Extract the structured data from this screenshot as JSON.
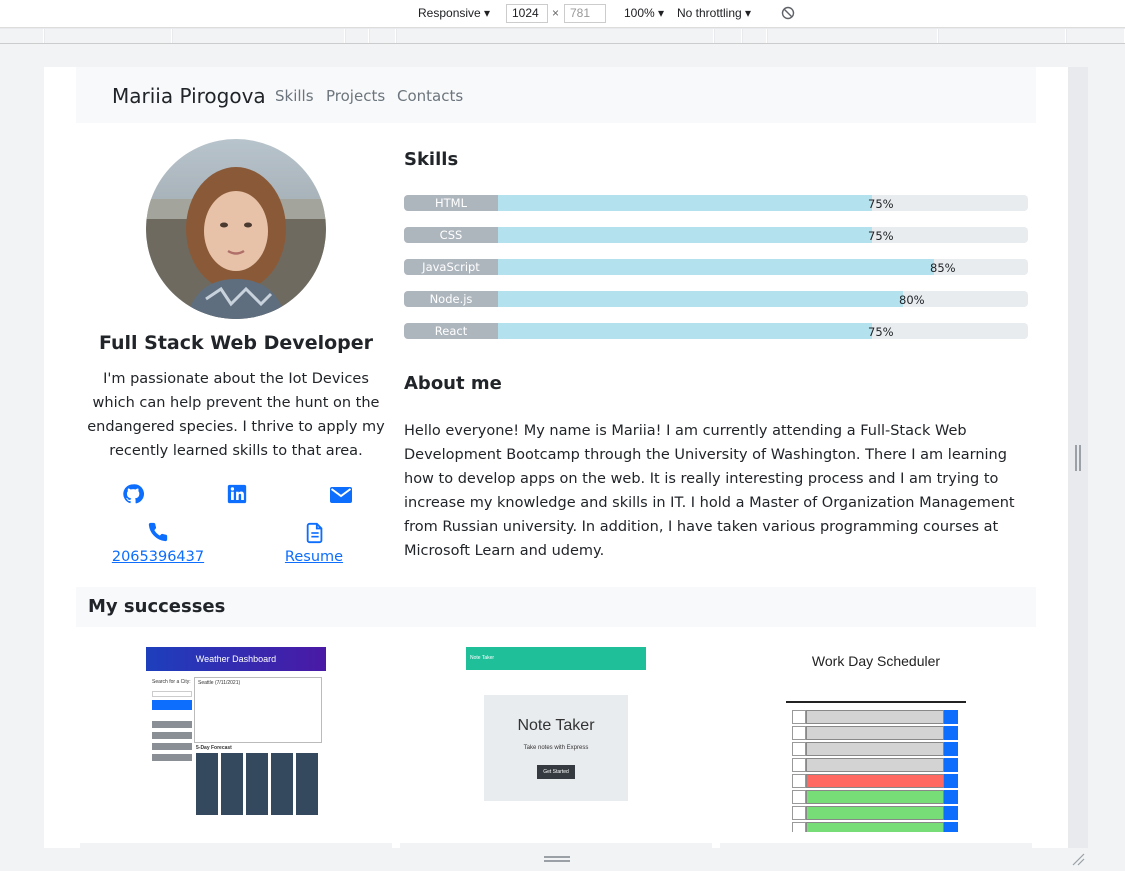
{
  "devtools": {
    "device": "Responsive",
    "width": "1024",
    "height": "781",
    "zoom": "100%",
    "throttling": "No throttling",
    "times": "×"
  },
  "nav": {
    "brand": "Mariia Pirogova",
    "links": [
      "Skills",
      "Projects",
      "Contacts"
    ]
  },
  "profile": {
    "role": "Full Stack Web Developer",
    "bio": "I'm passionate about the Iot Devices which can help prevent the hunt on the endangered species. I thrive to apply my recently learned skills to that area.",
    "phone": "2065396437",
    "resume": "Resume"
  },
  "skills": {
    "title": "Skills",
    "items": [
      {
        "name": "HTML",
        "percent": 75,
        "label": "75%"
      },
      {
        "name": "CSS",
        "percent": 75,
        "label": "75%"
      },
      {
        "name": "JavaScript",
        "percent": 85,
        "label": "85%"
      },
      {
        "name": "Node.js",
        "percent": 80,
        "label": "80%"
      },
      {
        "name": "React",
        "percent": 75,
        "label": "75%"
      }
    ]
  },
  "about": {
    "title": "About me",
    "text": "Hello everyone! My name is Mariia! I am currently attending a Full-Stack Web Development Bootcamp through the University of Washington. There I am learning how to develop apps on the web. It is really interesting process and I am trying to increase my knowledge and skills in IT. I hold a Master of Organization Management from Russian university. In addition, I have taken various programming courses at Microsoft Learn and udemy."
  },
  "successes": {
    "title": "My successes",
    "projects": [
      {
        "title": "Weather Dashboard",
        "search": "Search for a City:",
        "city": "Seattle (7/11/2021)",
        "forecast": "5-Day Forecast"
      },
      {
        "title": "Note Taker",
        "subtitle": "Take notes with Express",
        "button": "Get Started"
      },
      {
        "title": "Work Day Scheduler"
      }
    ]
  },
  "colors": {
    "accent": "#0d6efd",
    "bar_fill": "#b3e1ed",
    "bar_label": "#adb5bd"
  }
}
